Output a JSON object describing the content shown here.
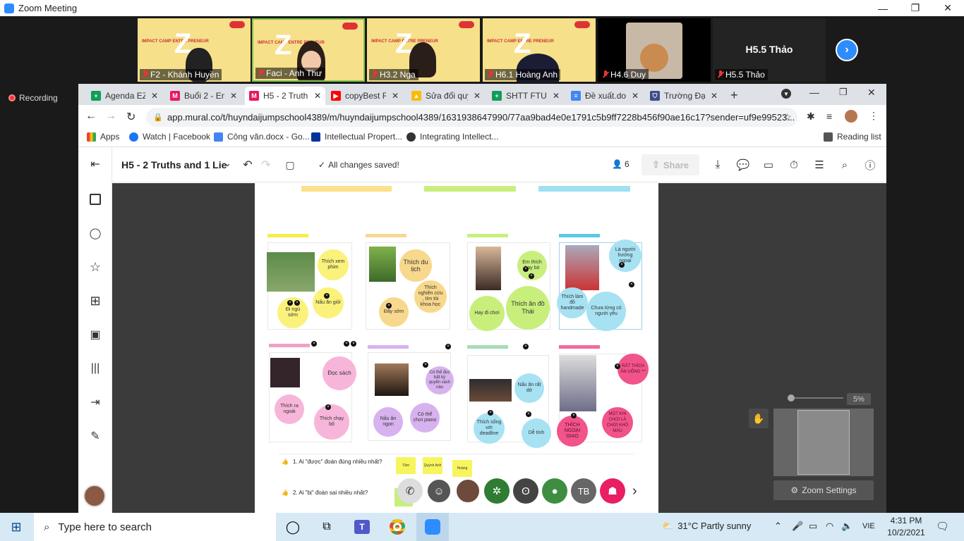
{
  "zoom": {
    "window_title": "Zoom Meeting",
    "recording": "Recording",
    "participants": [
      {
        "name": "F2 - Khánh Huyền"
      },
      {
        "name": "Faci - Anh Thư"
      },
      {
        "name": "H3.2 Nga"
      },
      {
        "name": "H6.1 Hoàng Anh"
      },
      {
        "name": "H4.6 Duy"
      },
      {
        "name": "H5.5 Thảo"
      }
    ],
    "camp_logo": "IMPACT CAMP ENTRE PRENEUR",
    "big_name": "H5.5 Thảo",
    "zoom_settings": "Zoom Settings",
    "zoom_pct": "5%"
  },
  "browser": {
    "tabs": [
      {
        "label": "Agenda EZ",
        "icon_color": "#0f9d58",
        "icon_glyph": "+"
      },
      {
        "label": "Buổi 2 - Em",
        "icon_color": "#e8175d",
        "icon_glyph": "M"
      },
      {
        "label": "H5 - 2 Truth",
        "icon_color": "#e8175d",
        "icon_glyph": "M"
      },
      {
        "label": "copyBest Re",
        "icon_color": "#ff0000",
        "icon_glyph": "▶"
      },
      {
        "label": "Sửa đổi quy",
        "icon_color": "#fbbc04",
        "icon_glyph": "▲"
      },
      {
        "label": "SHTT FTU",
        "icon_color": "#0f9d58",
        "icon_glyph": "+"
      },
      {
        "label": "Đề xuất.do",
        "icon_color": "#4285f4",
        "icon_glyph": "≡"
      },
      {
        "label": "Trường Đại",
        "icon_color": "#3c4c8c",
        "icon_glyph": "⛉"
      }
    ],
    "url": "app.mural.co/t/huyndaijumpschool4389/m/huyndaijumpschool4389/1631938647990/77aa9bad4e0e1791c5b9ff7228b456f90ae16c17?sender=uf9e99523...",
    "bookmarks": [
      "Apps",
      "Watch | Facebook",
      "Công văn.docx - Go...",
      "Intellectual Propert...",
      "Integrating Intellect..."
    ],
    "reading_list": "Reading list"
  },
  "mural": {
    "title": "H5 - 2 Truths and 1 Lie",
    "saved_status": "All changes saved!",
    "members_count": "6",
    "share_label": "Share",
    "cards": [
      {
        "circles": [
          "Thích xem phim",
          "Nấu ăn giỏi",
          "Đi ngủ sớm"
        ]
      },
      {
        "circles": [
          "Thích du lịch",
          "Thích nghiên cứu , tìm tòi khoa học",
          "Đây sớm"
        ]
      },
      {
        "circles": [
          "Em thích hay bỏ",
          "Thích ăn đồ Thái",
          "Hay đi chơi"
        ]
      },
      {
        "circles": [
          "Là người hướng ngoại",
          "Thích làm đồ handmade",
          "Chưa từng có người yêu"
        ]
      },
      {
        "circles": [
          "Đọc sách",
          "Thích ra ngoài",
          "Thích chạy bộ"
        ]
      },
      {
        "circles": [
          "Có thể đọc bất kỳ quyển sách nào",
          "Nấu ăn ngon",
          "Có thể chơi piano"
        ]
      },
      {
        "circles": [
          "Nấu ăn rất dở",
          "Thích sống với deadline",
          "Dễ tính"
        ]
      },
      {
        "circles": [
          "RẤT THÍCH ĂN UỐNG ^^",
          "THÍCH NGOẠI GIAO",
          "MỘT KHI CHƠI LÀ CHƠI KHÔ MÁU"
        ]
      }
    ],
    "questions": [
      "1. Ai \"được\" đoán đúng nhiều nhất?",
      "2. Ai \"bị\" đoán sai nhiều nhất?"
    ],
    "sticky_names": [
      "Tâm",
      "Quỳnh Anh",
      "Hoàng"
    ],
    "reaction_tb": "TB"
  },
  "taskbar": {
    "search_placeholder": "Type here to search",
    "weather": "31°C  Partly sunny",
    "lang": "VIE",
    "time": "4:31 PM",
    "date": "10/2/2021"
  }
}
